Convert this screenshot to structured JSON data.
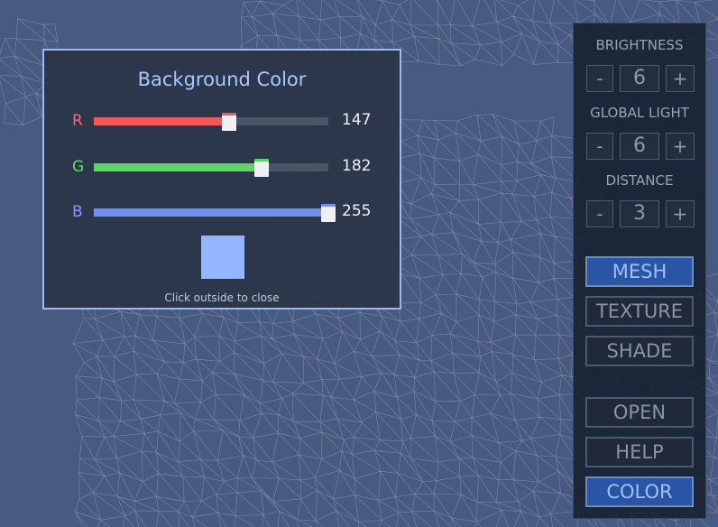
{
  "colors": {
    "background": "#475a82",
    "preview": "#93b6ff",
    "red_accent": "#f25a5a",
    "green_accent": "#5ad862",
    "blue_accent": "#6f8ff5",
    "active_button": "#2a55a6"
  },
  "popup": {
    "title": "Background Color",
    "sliders": [
      {
        "letter": "R",
        "value": "147",
        "fraction": 0.576
      },
      {
        "letter": "G",
        "value": "182",
        "fraction": 0.714
      },
      {
        "letter": "B",
        "value": "255",
        "fraction": 1.0
      }
    ],
    "hint": "Click outside to close"
  },
  "panel": {
    "brightness": {
      "label": "BRIGHTNESS",
      "minus": "-",
      "value": "6",
      "plus": "+"
    },
    "global_light": {
      "label": "GLOBAL LIGHT",
      "minus": "-",
      "value": "6",
      "plus": "+"
    },
    "distance": {
      "label": "DISTANCE",
      "minus": "-",
      "value": "3",
      "plus": "+"
    },
    "mode_buttons": [
      {
        "label": "MESH",
        "active": true
      },
      {
        "label": "TEXTURE",
        "active": false
      },
      {
        "label": "SHADE",
        "active": false
      }
    ],
    "action_buttons": [
      {
        "label": "OPEN",
        "active": false
      },
      {
        "label": "HELP",
        "active": false
      },
      {
        "label": "COLOR",
        "active": true
      }
    ]
  }
}
